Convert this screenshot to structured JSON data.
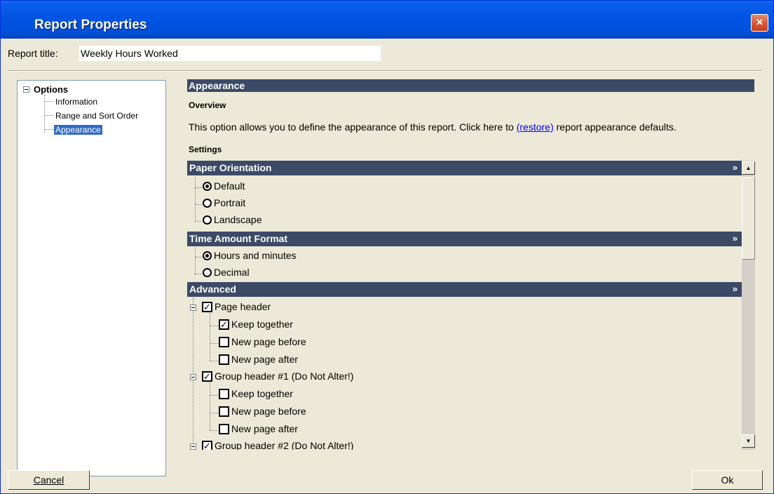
{
  "window": {
    "title": "Report Properties",
    "close_label": "×"
  },
  "report_title": {
    "label": "Report title:",
    "value": "Weekly Hours Worked"
  },
  "tree": {
    "root": "Options",
    "items": [
      "Information",
      "Range and Sort Order",
      "Appearance"
    ],
    "selected": "Appearance"
  },
  "section": {
    "title": "Appearance",
    "overview_label": "Overview",
    "overview_before": "This option allows you to define the appearance of this report. Click here to ",
    "overview_link": "(restore)",
    "overview_after": " report appearance defaults.",
    "settings_label": "Settings"
  },
  "groups": {
    "paper": {
      "title": "Paper Orientation",
      "options": [
        "Default",
        "Portrait",
        "Landscape"
      ],
      "selected": "Default"
    },
    "time": {
      "title": "Time Amount Format",
      "options": [
        "Hours and minutes",
        "Decimal"
      ],
      "selected": "Hours and minutes"
    },
    "advanced": {
      "title": "Advanced",
      "page_header": "Page header",
      "group_header_1": "Group header #1 (Do Not Alter!)",
      "group_header_2": "Group header #2 (Do Not Alter!)",
      "keep_together": "Keep together",
      "new_page_before": "New page before",
      "new_page_after": "New page after",
      "checked": {
        "page_header": true,
        "page_header_keep_together": true,
        "page_header_new_page_before": false,
        "page_header_new_page_after": false,
        "group_header_1": true,
        "group_header_1_keep_together": false,
        "group_header_1_new_page_before": false,
        "group_header_1_new_page_after": false,
        "group_header_2": true
      }
    },
    "chevron": "»"
  },
  "buttons": {
    "cancel": "Cancel",
    "ok": "Ok"
  },
  "colors": {
    "titlebar": "#0054e3",
    "section_bar": "#3c4a66",
    "selection": "#316ac5",
    "dialog_bg": "#ece9d8"
  }
}
